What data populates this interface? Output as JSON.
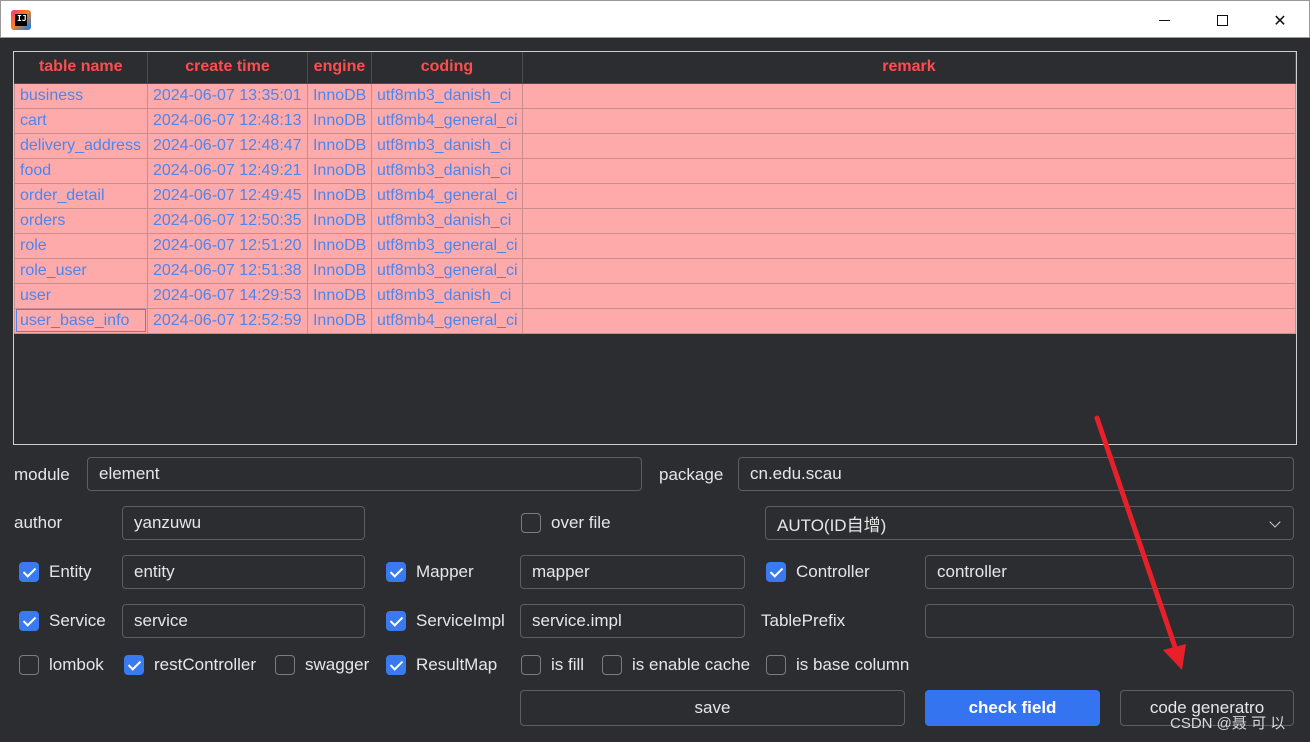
{
  "window": {
    "minimize": "",
    "maximize": "",
    "close": "✕"
  },
  "table": {
    "headers": [
      "table name",
      "create time",
      "engine",
      "coding",
      "remark"
    ],
    "rows": [
      [
        "business",
        "2024-06-07 13:35:01",
        "InnoDB",
        "utf8mb3_danish_ci",
        ""
      ],
      [
        "cart",
        "2024-06-07 12:48:13",
        "InnoDB",
        "utf8mb4_general_ci",
        ""
      ],
      [
        "delivery_address",
        "2024-06-07 12:48:47",
        "InnoDB",
        "utf8mb3_danish_ci",
        ""
      ],
      [
        "food",
        "2024-06-07 12:49:21",
        "InnoDB",
        "utf8mb3_danish_ci",
        ""
      ],
      [
        "order_detail",
        "2024-06-07 12:49:45",
        "InnoDB",
        "utf8mb4_general_ci",
        ""
      ],
      [
        "orders",
        "2024-06-07 12:50:35",
        "InnoDB",
        "utf8mb3_danish_ci",
        ""
      ],
      [
        "role",
        "2024-06-07 12:51:20",
        "InnoDB",
        "utf8mb3_general_ci",
        ""
      ],
      [
        "role_user",
        "2024-06-07 12:51:38",
        "InnoDB",
        "utf8mb3_general_ci",
        ""
      ],
      [
        "user",
        "2024-06-07 14:29:53",
        "InnoDB",
        "utf8mb3_danish_ci",
        ""
      ],
      [
        "user_base_info",
        "2024-06-07 12:52:59",
        "InnoDB",
        "utf8mb4_general_ci",
        ""
      ]
    ]
  },
  "form": {
    "module_label": "module",
    "module_value": "element",
    "package_label": "package",
    "package_value": "cn.edu.scau",
    "author_label": "author",
    "author_value": "yanzuwu",
    "over_file_label": "over file",
    "over_file_checked": false,
    "id_type_value": "AUTO(ID自增)",
    "entity_label": "Entity",
    "entity_value": "entity",
    "mapper_label": "Mapper",
    "mapper_value": "mapper",
    "controller_label": "Controller",
    "controller_value": "controller",
    "service_label": "Service",
    "service_value": "service",
    "serviceimpl_label": "ServiceImpl",
    "serviceimpl_value": "service.impl",
    "tableprefix_label": "TablePrefix",
    "tableprefix_value": "",
    "lombok_label": "lombok",
    "restcontroller_label": "restController",
    "swagger_label": "swagger",
    "resultmap_label": "ResultMap",
    "isfill_label": "is fill",
    "cache_label": "is enable cache",
    "basecolumn_label": "is base column"
  },
  "buttons": {
    "save": "save",
    "check_field": "check field",
    "code_generator": "code generatro"
  },
  "watermark": "CSDN @聂 可 以",
  "colors": {
    "accent": "#3574f0",
    "header_text": "#ff4d4d",
    "row_bg": "#ffaaaa",
    "row_text": "#4a86f0",
    "annotation_arrow": "#e8202a"
  }
}
